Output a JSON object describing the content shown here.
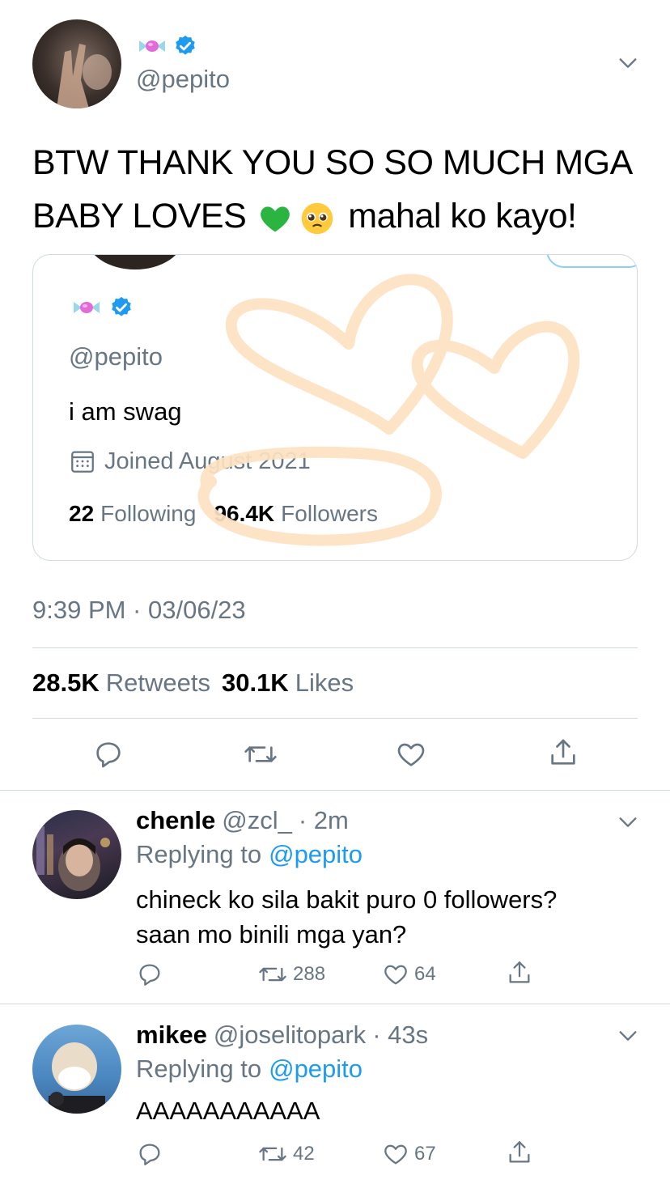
{
  "tweet": {
    "handle": "@pepito",
    "text_line1": "BTW THANK YOU SO SO MUCH MGA",
    "text_line2_prefix": "BABY LOVES",
    "text_line2_suffix": "mahal ko kayo!",
    "emojis": [
      "green-heart",
      "pleading-face"
    ],
    "timestamp": "9:39 PM · 03/06/23",
    "retweet_count": "28.5K",
    "retweets_label": "Retweets",
    "like_count": "30.1K",
    "likes_label": "Likes"
  },
  "embedded_profile": {
    "handle": "@pepito",
    "bio": "i am swag",
    "joined": "Joined August 2021",
    "following_count": "22",
    "following_label": "Following",
    "followers_count": "96.4K",
    "followers_label": "Followers"
  },
  "replies": [
    {
      "name": "chenle",
      "handle": "@zcl_",
      "time": "· 2m",
      "replying_prefix": "Replying to",
      "replying_to": "@pepito",
      "text_line1": "chineck ko sila bakit puro 0 followers?",
      "text_line2": "saan mo binili mga yan?",
      "retweets": "288",
      "likes": "64"
    },
    {
      "name": "mikee",
      "handle": "@joselitopark",
      "time": "· 43s",
      "replying_prefix": "Replying to",
      "replying_to": "@pepito",
      "text_line1": "AAAAAAAAAAA",
      "retweets": "42",
      "likes": "67"
    }
  ],
  "colors": {
    "accent": "#1d9bf0",
    "secondary_text": "#687684",
    "divider": "#cfd9de",
    "scribble": "#fde2c2"
  }
}
